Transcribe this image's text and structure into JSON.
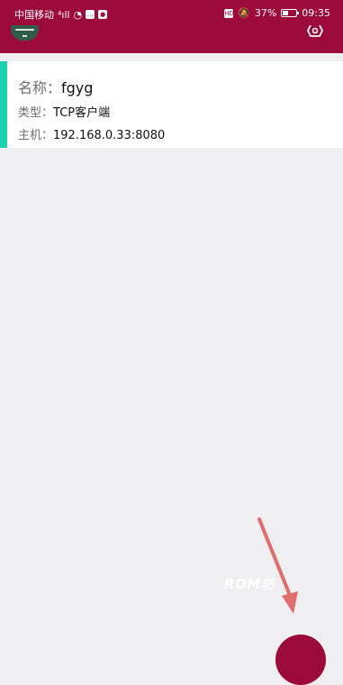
{
  "status_bar": {
    "carrier": "中国移动",
    "signal": "⁴ıll",
    "wifi": "◔",
    "battery_text": "37%",
    "time": "09:35",
    "icons": [
      "wifi-icon",
      "chat-icon",
      "penguin-icon",
      "hd-icon",
      "silent-icon",
      "battery-icon"
    ]
  },
  "header": {
    "menu_icon": "menu-icon",
    "settings_icon": "settings-icon"
  },
  "connection": {
    "name_label": "名称：",
    "name_value": "fgyg",
    "type_label": "类型：",
    "type_value": "TCP客户端",
    "host_label": "主机：",
    "host_value": "192.168.0.33:8080"
  },
  "watermark": {
    "text": "ROM坊"
  },
  "colors": {
    "app_bar": "#9b0a3b",
    "accent": "#19d2b0",
    "background": "#efeff1"
  }
}
